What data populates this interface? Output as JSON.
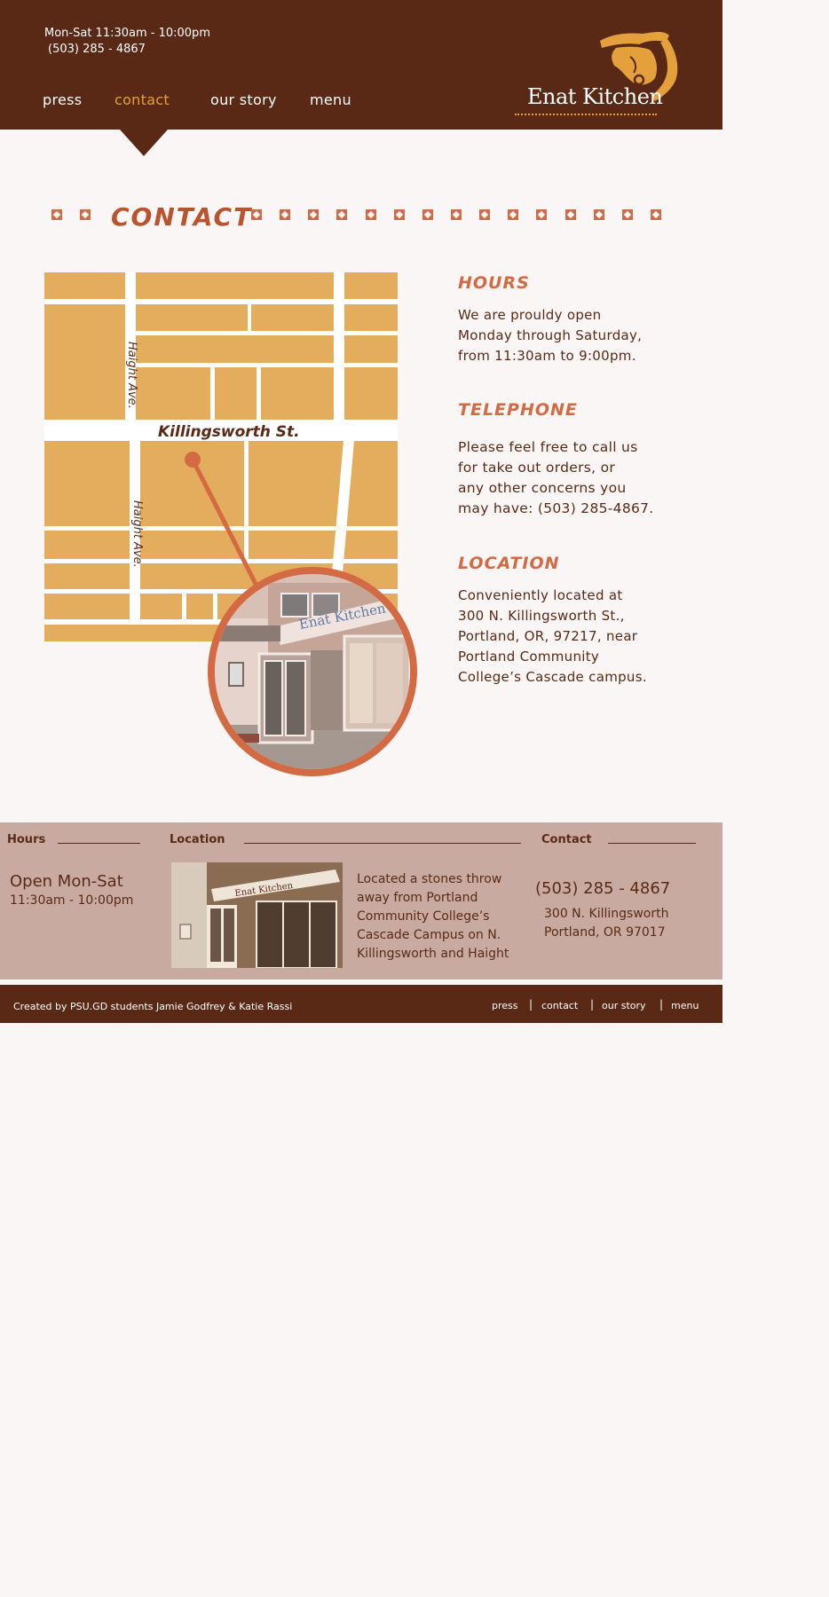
{
  "header": {
    "hours": "Mon-Sat  11:30am - 10:00pm",
    "phone": "(503) 285 - 4867",
    "nav": [
      "press",
      "contact",
      "our story",
      "menu"
    ],
    "active_nav": "contact",
    "logo": "Enat Kitchen"
  },
  "colors": {
    "brown": "#5a2916",
    "orange": "#d46a43",
    "gold": "#e4ad5d",
    "tan": "#c8aaa0"
  },
  "main": {
    "title": "CONTACT",
    "map": {
      "street_main": "Killingsworth St.",
      "street_side_1": "Haight Ave.",
      "street_side_2": "Haight Ave.",
      "storefront_sign": "Enat Kitchen"
    },
    "hours_heading": "HOURS",
    "hours_text": "We are prouldy open\nMonday through Saturday,\nfrom 11:30am to 9:00pm.",
    "telephone_heading": "TELEPHONE",
    "telephone_text": "Please feel free to call us\nfor take out orders, or\n any other concerns you\nmay have: (503) 285-4867.",
    "location_heading": "LOCATION",
    "location_text": "Conveniently located at\n300 N. Killingsworth St.,\n Portland, OR, 97217, near\nPortland Community\nCollege’s Cascade campus."
  },
  "footer_info": {
    "hours_heading": "Hours",
    "hours_open": "Open Mon-Sat",
    "hours_time": "11:30am - 10:00pm",
    "location_heading": "Location",
    "location_sign": "Enat Kitchen",
    "location_text": "Located a stones throw\naway from Portland\nCommunity College’s\nCascade Campus on N.\nKillingsworth and Haight",
    "contact_heading": "Contact",
    "contact_phone": "(503) 285 - 4867",
    "contact_address": "300 N. Killingsworth\nPortland, OR 97017"
  },
  "bottom_bar": {
    "credit": "Created by PSU.GD students Jamie Godfrey & Katie Rassi",
    "nav": [
      "press",
      "contact",
      "our story",
      "menu"
    ]
  }
}
